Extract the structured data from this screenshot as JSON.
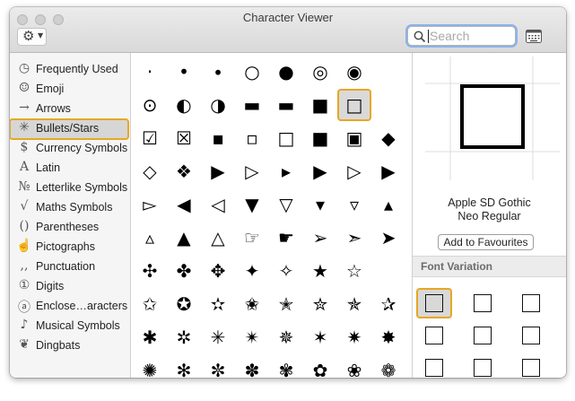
{
  "window": {
    "title": "Character Viewer"
  },
  "toolbar": {
    "action_icon": "gear-icon",
    "menu_arrow": "chevron-down-icon"
  },
  "search": {
    "placeholder": "Search",
    "value": ""
  },
  "sidebar": {
    "items": [
      {
        "label": "Frequently Used",
        "icon": "clock-icon",
        "glyph": "◷"
      },
      {
        "label": "Emoji",
        "icon": "smiley-icon",
        "glyph": "☺"
      },
      {
        "label": "Arrows",
        "icon": "arrow-icon",
        "glyph": "→"
      },
      {
        "label": "Bullets/Stars",
        "icon": "asterisk-icon",
        "glyph": "✳",
        "selected": true
      },
      {
        "label": "Currency Symbols",
        "icon": "dollar-icon",
        "glyph": "$"
      },
      {
        "label": "Latin",
        "icon": "latin-a-icon",
        "glyph": "A"
      },
      {
        "label": "Letterlike Symbols",
        "icon": "numero-icon",
        "glyph": "№"
      },
      {
        "label": "Maths Symbols",
        "icon": "square-root-icon",
        "glyph": "√"
      },
      {
        "label": "Parentheses",
        "icon": "parentheses-icon",
        "glyph": "()"
      },
      {
        "label": "Pictographs",
        "icon": "pictograph-icon",
        "glyph": "☝"
      },
      {
        "label": "Punctuation",
        "icon": "punctuation-icon",
        "glyph": ",,"
      },
      {
        "label": "Digits",
        "icon": "circled-one-icon",
        "glyph": "①"
      },
      {
        "label": "Enclose…aracters",
        "icon": "circled-a-icon",
        "glyph": "ⓐ"
      },
      {
        "label": "Musical Symbols",
        "icon": "note-icon",
        "glyph": "♪"
      },
      {
        "label": "Dingbats",
        "icon": "dingbat-icon",
        "glyph": "❦"
      }
    ]
  },
  "characters": {
    "rows": [
      [
        "·",
        "•",
        "∙",
        "○",
        "●",
        "◎",
        "◉"
      ],
      [
        "⊙",
        "◐",
        "◑",
        "▬",
        "▬",
        "■",
        "□"
      ],
      [
        "☑",
        "☒",
        "▪",
        "▫",
        "□",
        "■",
        "▣",
        "◆"
      ],
      [
        "◇",
        "❖",
        "▶",
        "▷",
        "▸",
        "▶",
        "▷",
        "▶"
      ],
      [
        "▻",
        "◀",
        "◁",
        "▼",
        "▽",
        "▾",
        "▿",
        "▴"
      ],
      [
        "▵",
        "▲",
        "△",
        "☞",
        "☛",
        "➢",
        "➣",
        "➤"
      ],
      [
        "✣",
        "✤",
        "✥",
        "✦",
        "✧",
        "★",
        "☆"
      ],
      [
        "✩",
        "✪",
        "✫",
        "✬",
        "✭",
        "✮",
        "✯",
        "✰"
      ],
      [
        "✱",
        "✲",
        "✳",
        "✴",
        "✵",
        "✶",
        "✷",
        "✸"
      ],
      [
        "✺",
        "✻",
        "✼",
        "✽",
        "✾",
        "✿",
        "❀",
        "❁"
      ]
    ],
    "selected_glyph": "□"
  },
  "detail": {
    "font_name_line1": "Apple SD Gothic",
    "font_name_line2": "Neo Regular",
    "add_favourites": "Add to Favourites",
    "font_variation_header": "Font Variation"
  },
  "colors": {
    "accent_highlight": "#e7a723",
    "selection_fill": "#d6d6d6"
  }
}
